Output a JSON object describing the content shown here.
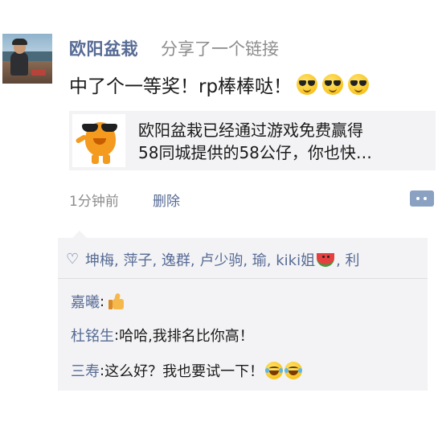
{
  "post": {
    "username": "欧阳盆栽",
    "action": "分享了一个链接",
    "content": "中了个一等奖！rp棒棒哒！",
    "content_emojis": [
      "cool-sunglasses-emoji",
      "cool-sunglasses-emoji",
      "cool-sunglasses-emoji"
    ],
    "link": {
      "line1": "欧阳盆栽已经通过游戏免费赢得",
      "line2": "58同城提供的58公仔，你也快…"
    },
    "time": "1分钟前",
    "delete_label": "删除"
  },
  "likes": {
    "icon": "heart-icon",
    "names_before": "坤梅, 萍子, 逸群, 卢少驹, 瑜, kiki姐",
    "names_after": ", 利"
  },
  "comments": [
    {
      "name": "嘉曦",
      "sep": ": ",
      "text": "",
      "icon": "thumbs-up-emoji"
    },
    {
      "name": "杜铭生",
      "sep": ": ",
      "text": "哈哈,我排名比你高！"
    },
    {
      "name": "三寿",
      "sep": ": ",
      "text": "这么好？我也要试一下！",
      "icon": "laughing-tears-emoji"
    }
  ],
  "colors": {
    "link_blue": "#576b95",
    "panel_bg": "#f3f3f5",
    "gray_text": "#8c8c8c"
  }
}
